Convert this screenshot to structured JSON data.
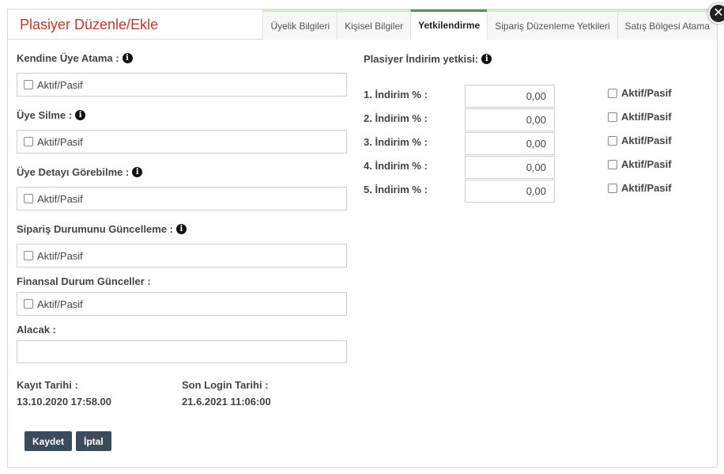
{
  "dialog": {
    "title": "Plasiyer Düzenle/Ekle",
    "close_glyph": "✕",
    "tabs": [
      {
        "label": "Üyelik Bilgileri"
      },
      {
        "label": "Kişisel Bilgiler"
      },
      {
        "label": "Yetkilendirme"
      },
      {
        "label": "Sipariş Düzenleme Yetkileri"
      },
      {
        "label": "Satış Bölgesi Atama"
      }
    ],
    "active_tab": "Yetkilendirme"
  },
  "left": {
    "fields": [
      {
        "label": "Kendine Üye Atama :",
        "has_info": true,
        "checkbox_label": "Aktif/Pasif"
      },
      {
        "label": "Üye Silme :",
        "has_info": true,
        "checkbox_label": "Aktif/Pasif"
      },
      {
        "label": "Üye Detayı Görebilme :",
        "has_info": true,
        "checkbox_label": "Aktif/Pasif"
      },
      {
        "label": "Sipariş Durumunu Güncelleme :",
        "has_info": true,
        "checkbox_label": "Aktif/Pasif"
      },
      {
        "label": "Finansal Durum Günceller :",
        "has_info": false,
        "checkbox_label": "Aktif/Pasif"
      }
    ],
    "alacak": {
      "label": "Alacak :",
      "value": ""
    },
    "kayit": {
      "label": "Kayıt Tarihi :",
      "value": "13.10.2020 17:58.00"
    },
    "login": {
      "label": "Son Login Tarihi :",
      "value": "21.6.2021 11:06:00"
    },
    "buttons": {
      "save": "Kaydet",
      "cancel": "İptal"
    }
  },
  "right": {
    "title": "Plasiyer İndirim yetkisi:",
    "discounts": [
      {
        "label": "1. İndirim % :",
        "value": "0,00",
        "checkbox_label": "Aktif/Pasif"
      },
      {
        "label": "2. İndirim % :",
        "value": "0,00",
        "checkbox_label": "Aktif/Pasif"
      },
      {
        "label": "3. İndirim % :",
        "value": "0,00",
        "checkbox_label": "Aktif/Pasif"
      },
      {
        "label": "4. İndirim % :",
        "value": "0,00",
        "checkbox_label": "Aktif/Pasif"
      },
      {
        "label": "5. İndirim % :",
        "value": "0,00",
        "checkbox_label": "Aktif/Pasif"
      }
    ]
  },
  "icons": {
    "info": "info-circle-icon",
    "close": "close-icon",
    "checkbox": "checkbox-icon"
  },
  "colors": {
    "title": "#c0392b",
    "active_tab_border": "#5e8f5b",
    "button_bg": "#3b4b5c"
  }
}
